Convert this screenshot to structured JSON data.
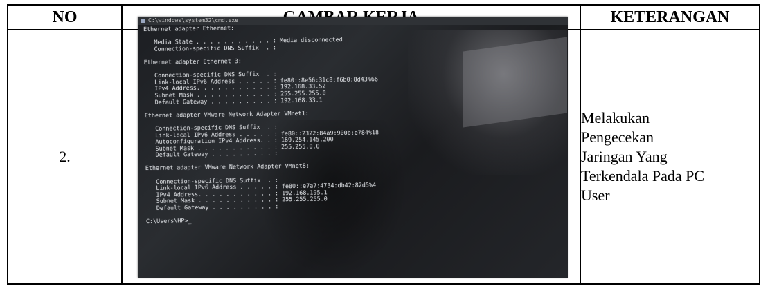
{
  "table": {
    "headers": {
      "no": "NO",
      "gambar": "GAMBAR KERJA",
      "keterangan": "KETERANGAN"
    },
    "row": {
      "no": "2.",
      "keterangan_lines": [
        "Melakukan",
        "Pengecekan",
        "Jaringan Yang",
        "Terkendala Pada PC",
        "User"
      ]
    }
  },
  "photo": {
    "window_title": "C:\\windows\\system32\\cmd.exe",
    "terminal_lines": [
      "Ethernet adapter Ethernet:",
      "",
      "   Media State . . . . . . . . . . . : Media disconnected",
      "   Connection-specific DNS Suffix  . :",
      "",
      "Ethernet adapter Ethernet 3:",
      "",
      "   Connection-specific DNS Suffix  . :",
      "   Link-local IPv6 Address . . . . . : fe80::8e56:31c8:f6b0:8d43%66",
      "   IPv4 Address. . . . . . . . . . . : 192.168.33.52",
      "   Subnet Mask . . . . . . . . . . . : 255.255.255.0",
      "   Default Gateway . . . . . . . . . : 192.168.33.1",
      "",
      "Ethernet adapter VMware Network Adapter VMnet1:",
      "",
      "   Connection-specific DNS Suffix  . :",
      "   Link-local IPv6 Address . . . . . : fe80::2322:84a9:900b:e784%18",
      "   Autoconfiguration IPv4 Address. . : 169.254.145.200",
      "   Subnet Mask . . . . . . . . . . . : 255.255.0.0",
      "   Default Gateway . . . . . . . . . :",
      "",
      "Ethernet adapter VMware Network Adapter VMnet8:",
      "",
      "   Connection-specific DNS Suffix  . :",
      "   Link-local IPv6 Address . . . . . : fe80::e7a7:4734:db42:82d5%4",
      "   IPv4 Address. . . . . . . . . . . : 192.168.195.1",
      "   Subnet Mask . . . . . . . . . . . : 255.255.255.0",
      "   Default Gateway . . . . . . . . . :",
      "",
      "C:\\Users\\HP>_"
    ]
  }
}
